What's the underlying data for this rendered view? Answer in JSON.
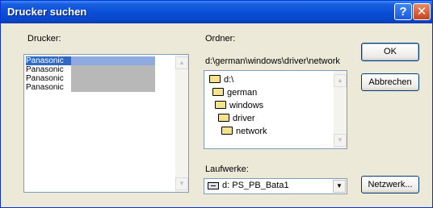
{
  "window": {
    "title": "Drucker suchen"
  },
  "titlebar": {
    "help_glyph": "?",
    "close_glyph": "✕"
  },
  "printers": {
    "label": "Drucker:",
    "items": [
      {
        "name": "Panasonic",
        "selected": true
      },
      {
        "name": "Panasonic",
        "selected": false
      },
      {
        "name": "Panasonic",
        "selected": false
      },
      {
        "name": "Panasonic",
        "selected": false
      }
    ]
  },
  "folder": {
    "label": "Ordner:",
    "path": "d:\\german\\windows\\driver\\network",
    "tree": [
      "d:\\",
      "german",
      "windows",
      "driver",
      "network"
    ]
  },
  "drives": {
    "label": "Laufwerke:",
    "selected": "d: PS_PB_Bata1"
  },
  "buttons": {
    "ok": "OK",
    "cancel": "Abbrechen",
    "network": "Netzwerk..."
  }
}
